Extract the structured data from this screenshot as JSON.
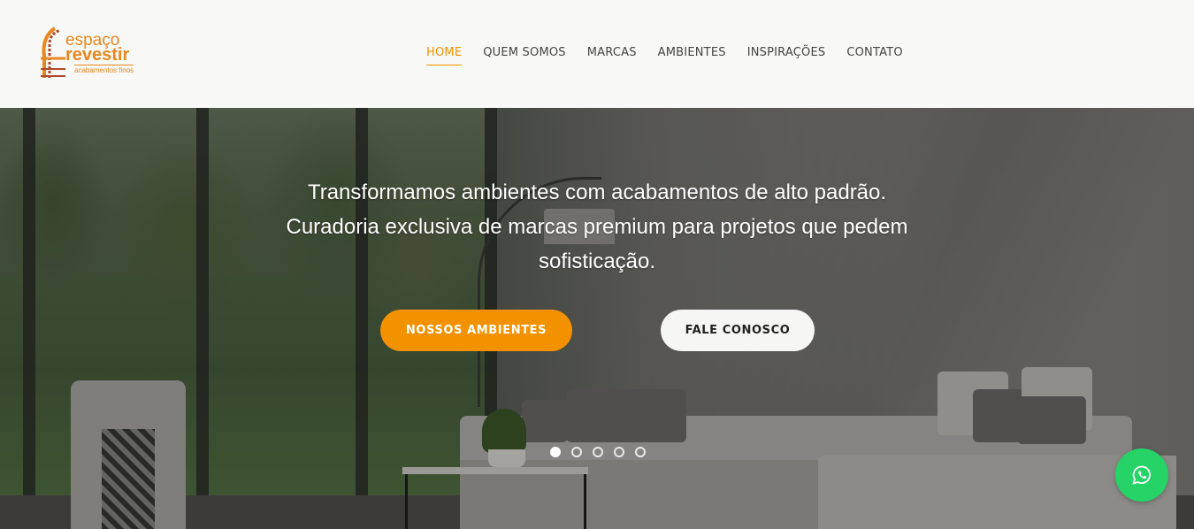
{
  "brand": {
    "name_line1": "espaço",
    "name_line2": "revestir",
    "tagline": "acabamentos finos",
    "accent_color": "#f39200"
  },
  "nav": {
    "items": [
      {
        "label": "HOME",
        "active": true
      },
      {
        "label": "QUEM SOMOS",
        "active": false
      },
      {
        "label": "MARCAS",
        "active": false
      },
      {
        "label": "AMBIENTES",
        "active": false
      },
      {
        "label": "INSPIRAÇÕES",
        "active": false
      },
      {
        "label": "CONTATO",
        "active": false
      }
    ]
  },
  "hero": {
    "line1": "Transformamos ambientes com acabamentos de alto padrão.",
    "line2": "Curadoria exclusiva de marcas premium para projetos que pedem",
    "line3": "sofisticação.",
    "primary_button": "NOSSOS AMBIENTES",
    "secondary_button": "FALE CONOSCO",
    "slider_count": 5,
    "active_slide": 1
  },
  "floating": {
    "whatsapp_icon": "whatsapp-icon",
    "whatsapp_color": "#25d366"
  }
}
